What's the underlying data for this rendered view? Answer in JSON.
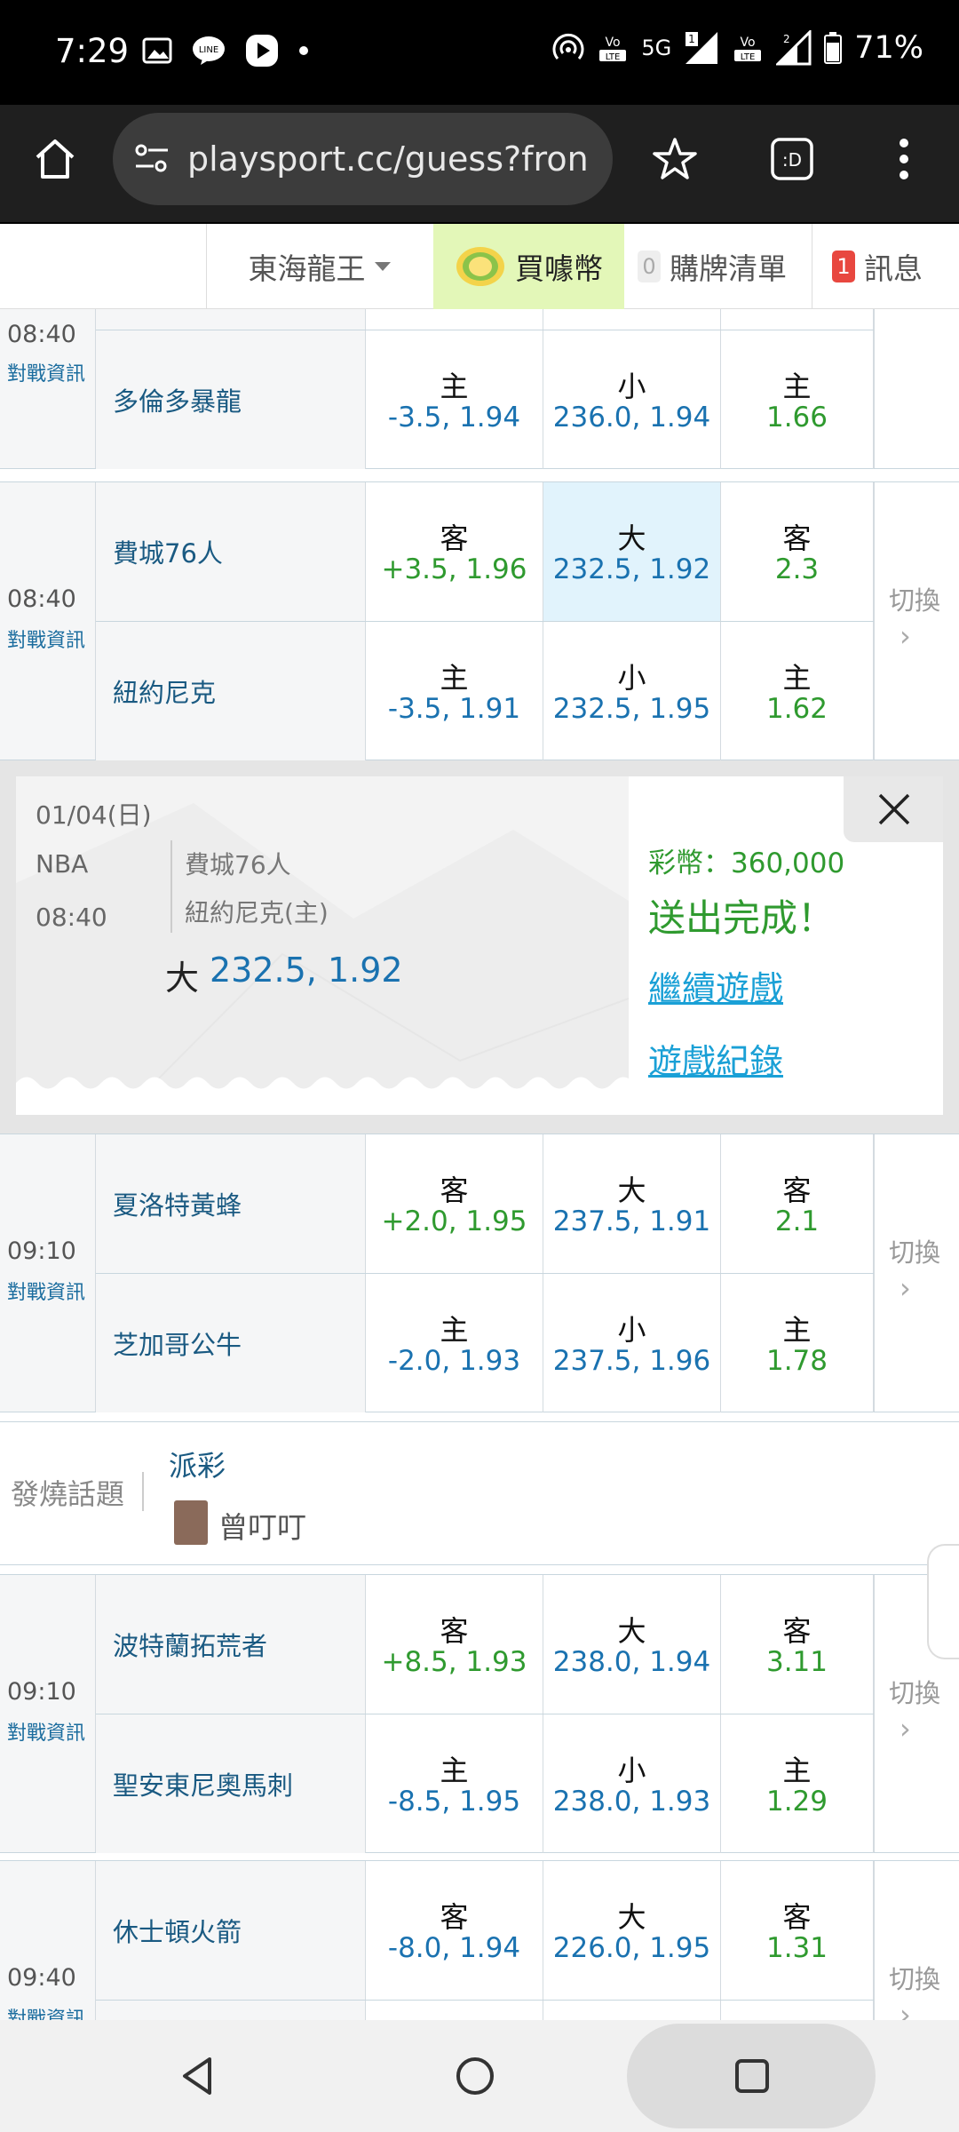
{
  "status_bar": {
    "time": "7:29",
    "network": "5G",
    "battery": "71%"
  },
  "browser": {
    "url": "playsport.cc/guess?fron"
  },
  "site_nav": {
    "user_name": "東海龍王",
    "buy_coins": "買噱幣",
    "cart_count": "0",
    "cart_label": "購牌清單",
    "msg_count": "1",
    "msg_label": "訊息"
  },
  "labels": {
    "info": "對戰資訊",
    "switch": "切換"
  },
  "games": [
    {
      "time": "08:40",
      "rows": [
        {
          "team": "",
          "spread_label": "",
          "spread": "",
          "total_label": "",
          "total": "",
          "ml_label": "",
          "ml": ""
        },
        {
          "team": "多倫多暴龍",
          "spread_label": "主",
          "spread": "-3.5, 1.94",
          "total_label": "小",
          "total": "236.0, 1.94",
          "ml_label": "主",
          "ml": "1.66"
        }
      ]
    },
    {
      "time": "08:40",
      "rows": [
        {
          "team": "費城76人",
          "spread_label": "客",
          "spread": "+3.5, 1.96",
          "total_label": "大",
          "total": "232.5, 1.92",
          "ml_label": "客",
          "ml": "2.3"
        },
        {
          "team": "紐約尼克",
          "spread_label": "主",
          "spread": "-3.5, 1.91",
          "total_label": "小",
          "total": "232.5, 1.95",
          "ml_label": "主",
          "ml": "1.62"
        }
      ]
    },
    {
      "time": "09:10",
      "rows": [
        {
          "team": "夏洛特黃蜂",
          "spread_label": "客",
          "spread": "+2.0, 1.95",
          "total_label": "大",
          "total": "237.5, 1.91",
          "ml_label": "客",
          "ml": "2.1"
        },
        {
          "team": "芝加哥公牛",
          "spread_label": "主",
          "spread": "-2.0, 1.93",
          "total_label": "小",
          "total": "237.5, 1.96",
          "ml_label": "主",
          "ml": "1.78"
        }
      ]
    },
    {
      "time": "09:10",
      "rows": [
        {
          "team": "波特蘭拓荒者",
          "spread_label": "客",
          "spread": "+8.5, 1.93",
          "total_label": "大",
          "total": "238.0, 1.94",
          "ml_label": "客",
          "ml": "3.11"
        },
        {
          "team": "聖安東尼奧馬刺",
          "spread_label": "主",
          "spread": "-8.5, 1.95",
          "total_label": "小",
          "total": "238.0, 1.93",
          "ml_label": "主",
          "ml": "1.29"
        }
      ]
    },
    {
      "time": "09:40",
      "rows": [
        {
          "team": "休士頓火箭",
          "spread_label": "客",
          "spread": "-8.0, 1.94",
          "total_label": "大",
          "total": "226.0, 1.95",
          "ml_label": "客",
          "ml": "1.31"
        },
        {
          "team": "",
          "spread_label": "",
          "spread": "",
          "total_label": "",
          "total": "",
          "ml_label": "",
          "ml": ""
        }
      ]
    }
  ],
  "confirmation": {
    "date": "01/04(日)",
    "league": "NBA",
    "time": "08:40",
    "away_team": "費城76人",
    "home_team": "紐約尼克(主)",
    "pick_label": "大",
    "pick_value": "232.5, 1.92",
    "coins": "彩幣：360,000",
    "success": "送出完成！",
    "continue_link": "繼續遊戲",
    "history_link": "遊戲紀錄"
  },
  "hot_topics": {
    "label": "發燒話題",
    "title": "派彩",
    "author": "曾叮叮"
  },
  "colors": {
    "spread_blue": "#1a72b0",
    "odds_green": "#2f9a2f",
    "selected_bg": "#e1f3fc",
    "buy_bg": "#e3f7b8",
    "msg_badge": "#e8473f"
  }
}
